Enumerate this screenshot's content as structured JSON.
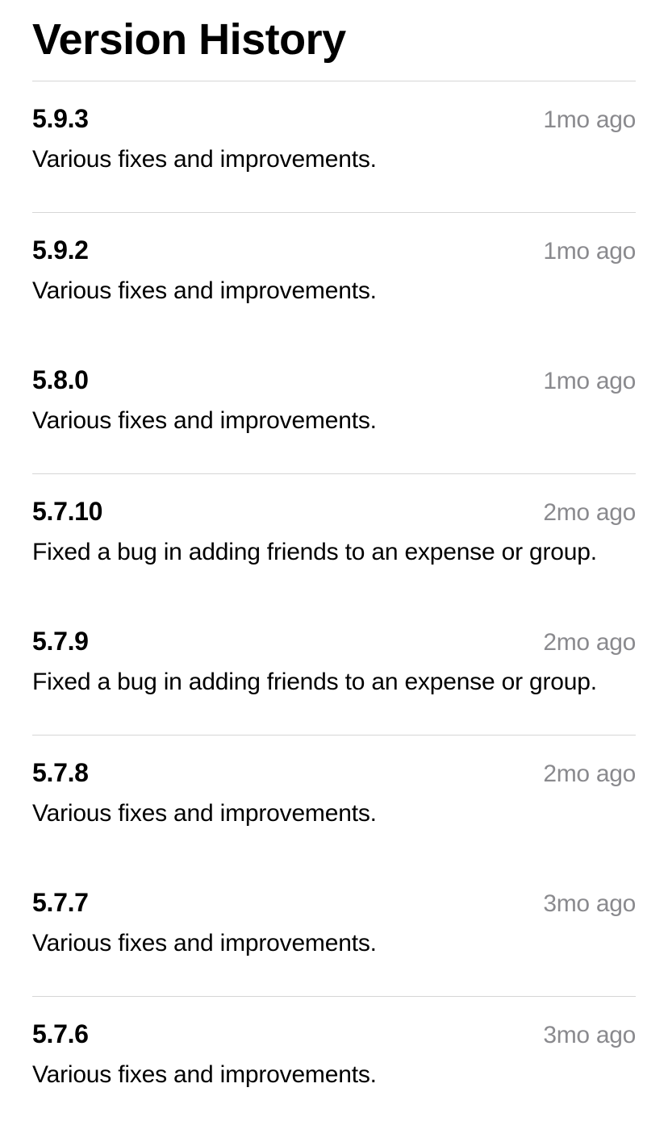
{
  "title": "Version History",
  "versions": [
    {
      "number": "5.9.3",
      "age": "1mo ago",
      "notes": "Various fixes and improvements."
    },
    {
      "number": "5.9.2",
      "age": "1mo ago",
      "notes": "Various fixes and improvements."
    },
    {
      "number": "5.8.0",
      "age": "1mo ago",
      "notes": "Various fixes and improvements."
    },
    {
      "number": "5.7.10",
      "age": "2mo ago",
      "notes": "Fixed a bug in adding friends to an expense or group."
    },
    {
      "number": "5.7.9",
      "age": "2mo ago",
      "notes": "Fixed a bug in adding friends to an expense or group."
    },
    {
      "number": "5.7.8",
      "age": "2mo ago",
      "notes": "Various fixes and improvements."
    },
    {
      "number": "5.7.7",
      "age": "3mo ago",
      "notes": "Various fixes and improvements."
    },
    {
      "number": "5.7.6",
      "age": "3mo ago",
      "notes": "Various fixes and improvements."
    }
  ],
  "borders_after_indices": [
    0,
    2,
    4,
    6
  ]
}
